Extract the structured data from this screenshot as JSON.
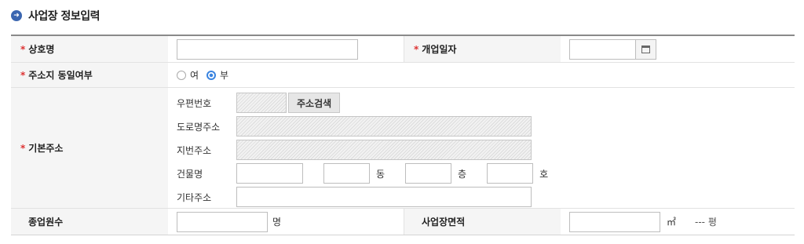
{
  "section": {
    "title": "사업장 정보입력",
    "icon": "arrow-right-circle-icon"
  },
  "required_mark": "*",
  "fields": {
    "company_name": {
      "label": "상호명",
      "value": ""
    },
    "open_date": {
      "label": "개업일자",
      "value": ""
    },
    "same_address": {
      "label": "주소지 동일여부",
      "options": [
        "여",
        "부"
      ],
      "selected": "부"
    },
    "base_address": {
      "label": "기본주소",
      "postal_code": {
        "label": "우편번호",
        "value": ""
      },
      "search_button": "주소검색",
      "road_address": {
        "label": "도로명주소",
        "value": ""
      },
      "lot_address": {
        "label": "지번주소",
        "value": ""
      },
      "building": {
        "label": "건물명",
        "value": "",
        "dong_unit": "동",
        "floor_unit": "층",
        "ho_unit": "호"
      },
      "etc_address": {
        "label": "기타주소",
        "value": ""
      }
    },
    "employees": {
      "label": "종업원수",
      "unit": "명",
      "value": ""
    },
    "area": {
      "label": "사업장면적",
      "unit": "㎡",
      "pyeong": "--- 평",
      "value": ""
    }
  },
  "colors": {
    "accent": "#3b66b0",
    "required": "#dd3333",
    "radio": "#3a84e0"
  }
}
